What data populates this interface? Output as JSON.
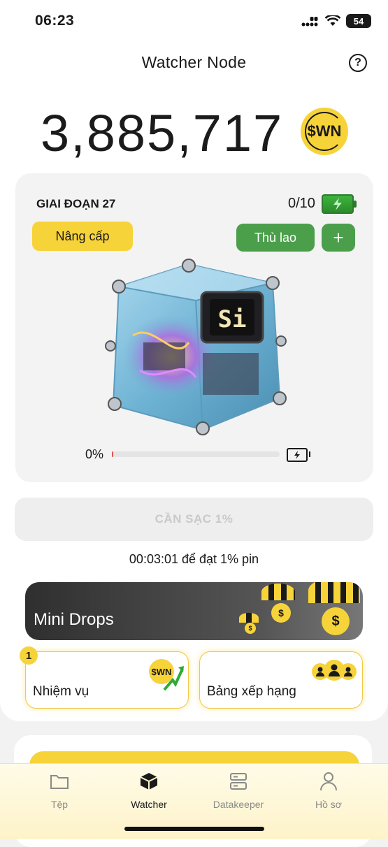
{
  "status_bar": {
    "time": "06:23",
    "battery": "54"
  },
  "header": {
    "title": "Watcher Node",
    "help": "?"
  },
  "balance": {
    "amount": "3,885,717",
    "token": "$WN"
  },
  "stage": {
    "label": "GIAI ĐOẠN 27",
    "capacity": "0/10",
    "upgrade_label": "Nâng cấp",
    "reward_label": "Thù lao",
    "plus_label": "+",
    "progress_text": "0%",
    "progress_fraction": 0.01,
    "device_badge": "Si"
  },
  "charge": {
    "button_label": "CẦN SẠC 1%",
    "timer_text": "00:03:01 để đạt 1% pin"
  },
  "mini_drops": {
    "title": "Mini Drops"
  },
  "tasks": {
    "badge_count": "1",
    "mission_label": "Nhiệm vụ",
    "mission_token": "$WN",
    "leaderboard_label": "Bảng xếp hạng"
  },
  "nav": {
    "items": [
      {
        "label": "Tệp",
        "icon": "folder-icon"
      },
      {
        "label": "Watcher",
        "icon": "cube-icon"
      },
      {
        "label": "Datakeeper",
        "icon": "server-icon"
      },
      {
        "label": "Hồ sơ",
        "icon": "user-icon"
      }
    ],
    "active": "Watcher"
  },
  "colors": {
    "accent": "#f7d33a",
    "green": "#4b9f4b",
    "dark": "#1a1a1a"
  }
}
